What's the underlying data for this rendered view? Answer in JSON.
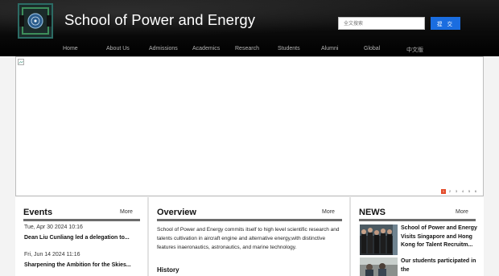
{
  "header": {
    "site_title": "School of Power and Energy",
    "search_placeholder": "全文搜索",
    "search_button": "提 交"
  },
  "nav": {
    "items": [
      "Home",
      "About Us",
      "Admissions",
      "Academics",
      "Research",
      "Students",
      "Alumni",
      "Global",
      "中文版"
    ]
  },
  "banner": {
    "pager": [
      "1",
      "2",
      "3",
      "4",
      "5",
      "6"
    ],
    "active_page": 1,
    "colors": {
      "active_dot": "#e34b2a"
    }
  },
  "events": {
    "title": "Events",
    "more": "More",
    "items": [
      {
        "date": "Tue, Apr 30 2024 10:16",
        "title": "Dean Liu Cunliang led a delegation to..."
      },
      {
        "date": "Fri, Jun 14 2024 11:16",
        "title": "Sharpening the Ambition for the Skies..."
      }
    ]
  },
  "overview": {
    "title": "Overview",
    "more": "More",
    "text": "School of Power and Energy commits itself to high level scientific research and talents cultivation in aircraft engine and alternative energy,with distinctive features inaeronautics, astronautics, and marine technology.",
    "history_label": "History"
  },
  "news": {
    "title": "NEWS",
    "more": "More",
    "items": [
      {
        "title": "School of Power and Energy Visits Singapore and Hong Kong for Talent Recruitm..."
      },
      {
        "title": "Our students participated in the"
      }
    ]
  },
  "colors": {
    "search_button": "#1a6de0",
    "header_bg": "#000000",
    "nav_text": "#b5b5b5"
  }
}
